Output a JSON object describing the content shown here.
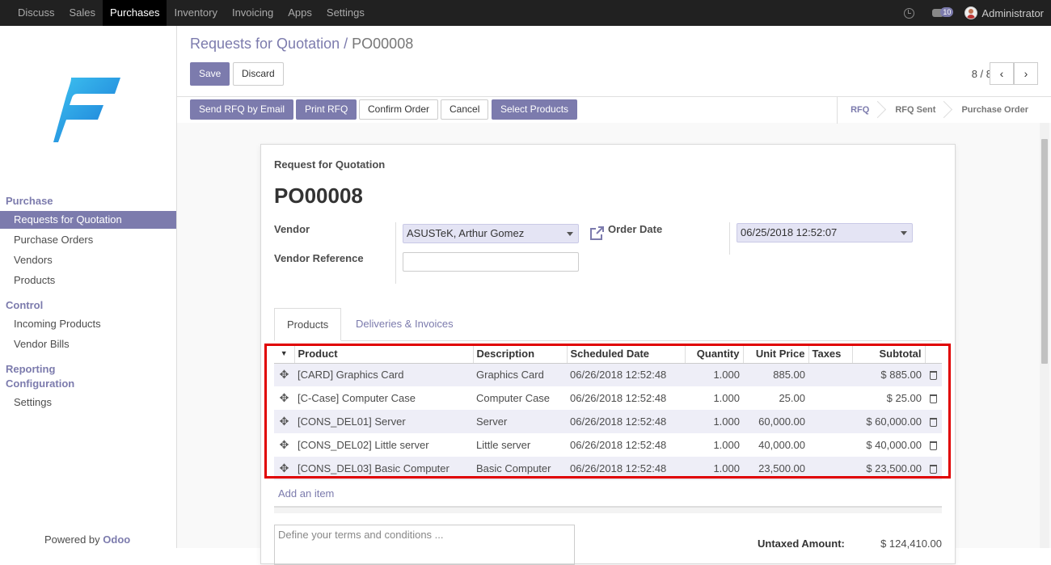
{
  "topbar": {
    "menu": [
      "Discuss",
      "Sales",
      "Purchases",
      "Inventory",
      "Invoicing",
      "Apps",
      "Settings"
    ],
    "active_menu": "Purchases",
    "chat_count": "10",
    "user": "Administrator"
  },
  "sidebar": {
    "sections": [
      {
        "title": "Purchase",
        "items": [
          "Requests for Quotation",
          "Purchase Orders",
          "Vendors",
          "Products"
        ]
      },
      {
        "title": "Control",
        "items": [
          "Incoming Products",
          "Vendor Bills"
        ]
      },
      {
        "title": "Reporting",
        "items": []
      },
      {
        "title": "Configuration",
        "items": [
          "Settings"
        ]
      }
    ],
    "active_item": "Requests for Quotation",
    "powered_prefix": "Powered by ",
    "powered_brand": "Odoo"
  },
  "breadcrumb": {
    "parent": "Requests for Quotation",
    "sep": "/",
    "current": "PO00008"
  },
  "buttons": {
    "save": "Save",
    "discard": "Discard"
  },
  "pager": {
    "text": "8 / 8",
    "prev": "‹",
    "next": "›"
  },
  "statusbar": {
    "actions": [
      "Send RFQ by Email",
      "Print RFQ",
      "Confirm Order",
      "Cancel",
      "Select Products"
    ],
    "stages": [
      "RFQ",
      "RFQ Sent",
      "Purchase Order"
    ],
    "current_stage": "RFQ"
  },
  "form": {
    "heading": "Request for Quotation",
    "name": "PO00008",
    "vendor_label": "Vendor",
    "vendor_value": "ASUSTeK, Arthur Gomez",
    "vendor_ref_label": "Vendor Reference",
    "vendor_ref_value": "",
    "order_date_label": "Order Date",
    "order_date_value": "06/25/2018 12:52:07"
  },
  "tabs": [
    "Products",
    "Deliveries & Invoices"
  ],
  "lines": {
    "columns": [
      "Product",
      "Description",
      "Scheduled Date",
      "Quantity",
      "Unit Price",
      "Taxes",
      "Subtotal"
    ],
    "rows": [
      {
        "product": "[CARD] Graphics Card",
        "description": "Graphics Card",
        "date": "06/26/2018 12:52:48",
        "qty": "1.000",
        "price": "885.00",
        "taxes": "",
        "subtotal": "$ 885.00"
      },
      {
        "product": "[C-Case] Computer Case",
        "description": "Computer Case",
        "date": "06/26/2018 12:52:48",
        "qty": "1.000",
        "price": "25.00",
        "taxes": "",
        "subtotal": "$ 25.00"
      },
      {
        "product": "[CONS_DEL01] Server",
        "description": "Server",
        "date": "06/26/2018 12:52:48",
        "qty": "1.000",
        "price": "60,000.00",
        "taxes": "",
        "subtotal": "$ 60,000.00"
      },
      {
        "product": "[CONS_DEL02] Little server",
        "description": "Little server",
        "date": "06/26/2018 12:52:48",
        "qty": "1.000",
        "price": "40,000.00",
        "taxes": "",
        "subtotal": "$ 40,000.00"
      },
      {
        "product": "[CONS_DEL03] Basic Computer",
        "description": "Basic Computer",
        "date": "06/26/2018 12:52:48",
        "qty": "1.000",
        "price": "23,500.00",
        "taxes": "",
        "subtotal": "$ 23,500.00"
      }
    ],
    "add_item": "Add an item"
  },
  "terms_placeholder": "Define your terms and conditions ...",
  "totals": {
    "untaxed_label": "Untaxed Amount:",
    "untaxed_value": "$ 124,410.00"
  },
  "colors": {
    "accent": "#7c7bad",
    "topbar": "#212121",
    "highlight": "#e00000"
  }
}
